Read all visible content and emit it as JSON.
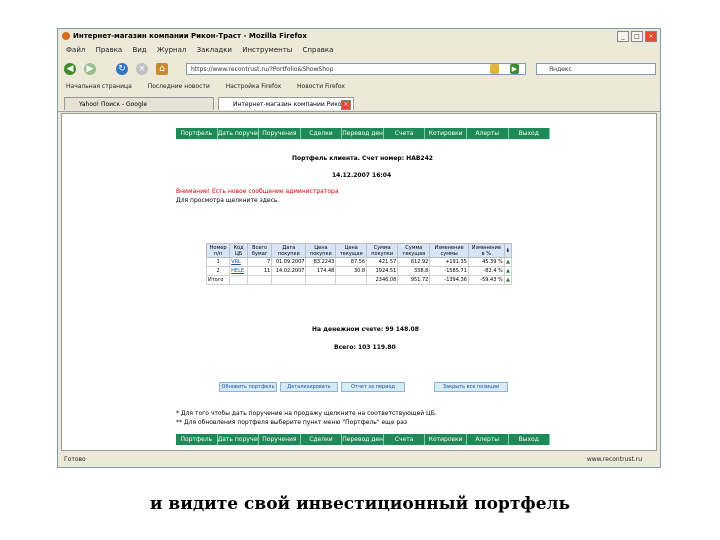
{
  "window": {
    "title": "Интернет-магазин компании Рикон-Траст - Mozilla Firefox",
    "controls": [
      "_",
      "□",
      "×"
    ]
  },
  "menu": [
    "Файл",
    "Правка",
    "Вид",
    "Журнал",
    "Закладки",
    "Инструменты",
    "Справка"
  ],
  "address": {
    "url": "https://www.recontrust.ru/?Portfolio&ShowShop",
    "search_placeholder": "Яндекс"
  },
  "bookmarks": [
    "Начальная страница",
    "Последние новости",
    "Настройка Firefox",
    "Новости Firefox"
  ],
  "tabs": [
    "Yahoo! Поиск - Google",
    "Интернет-магазин компании Рикон..."
  ],
  "site_nav": [
    "Портфель",
    "Дать поручение",
    "Поручения",
    "Сделки",
    "Перевод денег",
    "Счета",
    "Котировки",
    "Алерты",
    "Выход"
  ],
  "portfolio": {
    "client_line": "Портфель клиента. Счет номер: HAB242",
    "datetime": "14.12.2007   16:04",
    "warning": "Внимание! Есть новое сообщение администратора",
    "view_link": "Для просмотра щелкните здесь.",
    "headers": [
      "Номер п/п",
      "Код ЦБ",
      "Всего бумаг",
      "Дата покупки",
      "Цена покупки",
      "Цена текущая",
      "Сумма покупки",
      "Сумма текущая",
      "Изменение суммы",
      "Изменение в %"
    ],
    "rows": [
      [
        "1",
        "VRL",
        "7",
        "01.09.2007",
        "83.2243",
        "87.56",
        "421.57",
        "612.92",
        "+191.35",
        "45.39 %"
      ],
      [
        "2",
        "HELE",
        "11",
        "14.02.2007",
        "174.48",
        "30.8",
        "1924.51",
        "338.8",
        "-1585.71",
        "-82.4 %"
      ],
      [
        "Итого",
        "",
        "",
        "",
        "",
        "",
        "2346.08",
        "951.72",
        "-1394.36",
        "-59.43 %"
      ]
    ],
    "cash": "На денежном счете: 99 148.08",
    "total": "Всего: 103 119.80"
  },
  "actions": [
    "Обновить портфель",
    "Детализировать",
    "Отчет за период",
    "Закрыть все позиции"
  ],
  "notes": [
    "* Для того чтобы дать поручение на продажу щелкните на соответствующей ЦБ.",
    "** Для обновления портфеля выберите пункт меню \"Портфель\" еще раз"
  ],
  "status": {
    "left": "Готово",
    "right": "www.recontrust.ru"
  },
  "caption": "и видите свой инвестиционный портфель",
  "colors": {
    "nav_green": "#1d8a57",
    "warning_red": "#d40000",
    "table_header": "#d5e4f7"
  }
}
